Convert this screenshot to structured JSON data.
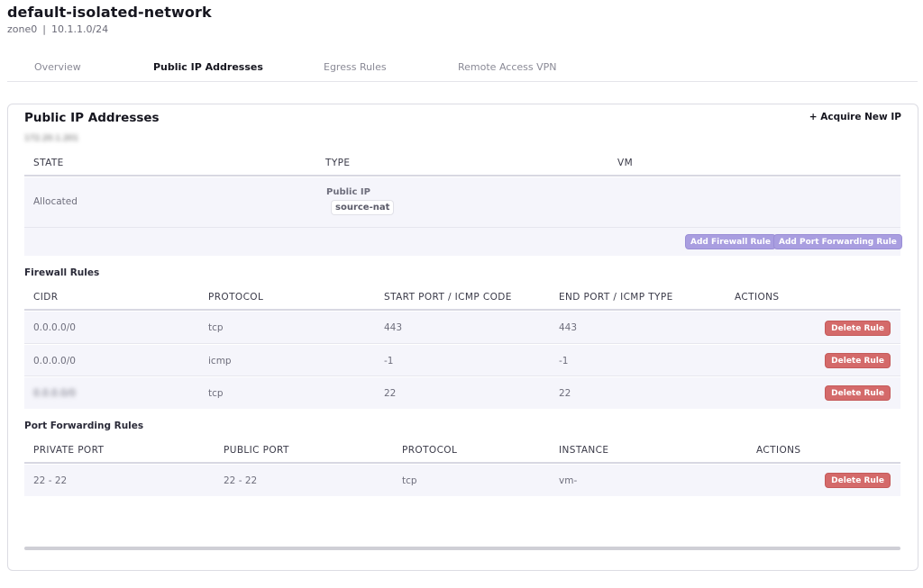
{
  "header": {
    "title": "default-isolated-network",
    "zone": "zone0",
    "separator": "|",
    "cidr": "10.1.1.0/24"
  },
  "tabs": [
    {
      "label": "Overview",
      "active": false
    },
    {
      "label": "Public IP Addresses",
      "active": true
    },
    {
      "label": "Egress Rules",
      "active": false
    },
    {
      "label": "Remote Access VPN",
      "active": false
    }
  ],
  "card": {
    "title": "Public IP Addresses",
    "acquire_label": "+ Acquire New IP",
    "ip_address": "172.20.1.201",
    "ip_table": {
      "headers": [
        "STATE",
        "TYPE",
        "VM"
      ],
      "row": {
        "state": "Allocated",
        "type_label": "Public IP",
        "type_tag": "source-nat",
        "vm": ""
      },
      "actions": {
        "add_firewall": "Add Firewall Rule",
        "add_port_forwarding": "Add Port Forwarding Rule"
      }
    },
    "firewall": {
      "label": "Firewall Rules",
      "headers": [
        "CIDR",
        "PROTOCOL",
        "START PORT / ICMP CODE",
        "END PORT / ICMP TYPE",
        "ACTIONS"
      ],
      "rows": [
        {
          "cidr": "0.0.0.0/0",
          "protocol": "tcp",
          "start": "443",
          "end": "443",
          "action": "Delete Rule"
        },
        {
          "cidr": "0.0.0.0/0",
          "protocol": "icmp",
          "start": "-1",
          "end": "-1",
          "action": "Delete Rule"
        },
        {
          "cidr": "0.0.0.0/0",
          "protocol": "tcp",
          "start": "22",
          "end": "22",
          "action": "Delete Rule"
        }
      ]
    },
    "port_forwarding": {
      "label": "Port Forwarding Rules",
      "headers": [
        "PRIVATE PORT",
        "PUBLIC PORT",
        "PROTOCOL",
        "INSTANCE",
        "ACTIONS"
      ],
      "rows": [
        {
          "private": "22 - 22",
          "public": "22 - 22",
          "protocol": "tcp",
          "instance": "vm-",
          "action": "Delete Rule"
        }
      ]
    }
  }
}
